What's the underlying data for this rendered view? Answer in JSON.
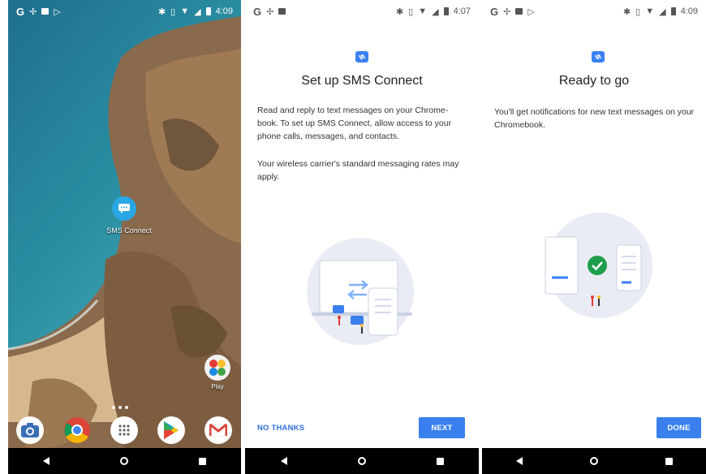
{
  "screens": [
    {
      "status": {
        "time": "4:09",
        "left_icons": [
          "google-g-icon",
          "fan-icon",
          "image-icon",
          "play-store-icon"
        ],
        "right_icons": [
          "bluetooth-icon",
          "vibrate-icon",
          "wifi-icon",
          "signal-icon",
          "battery-icon"
        ]
      },
      "home": {
        "sms_app_label": "SMS Connect",
        "dock": [
          {
            "name": "camera-icon"
          },
          {
            "name": "chrome-icon"
          },
          {
            "name": "app-drawer-icon"
          },
          {
            "name": "play-store-icon"
          },
          {
            "name": "gmail-icon"
          }
        ],
        "play_folder_label": "Play"
      }
    },
    {
      "status": {
        "time": "4:07"
      },
      "title": "Set up SMS Connect",
      "paragraph1": "Read and reply to text messages on your Chrome-book. To set up SMS Connect, allow access to your phone calls, messages, and contacts.",
      "paragraph2": "Your wireless carrier's standard messaging rates may apply.",
      "secondary_button": "NO THANKS",
      "primary_button": "NEXT"
    },
    {
      "status": {
        "time": "4:09"
      },
      "title": "Ready to go",
      "paragraph1": "You'll get notifications for new text messages on your Chromebook.",
      "primary_button": "DONE"
    }
  ],
  "colors": {
    "accent": "#3a7fee",
    "sms_icon": "#29a8e5",
    "check": "#1e9e4a",
    "illustration_bg": "#e9ecf4"
  }
}
